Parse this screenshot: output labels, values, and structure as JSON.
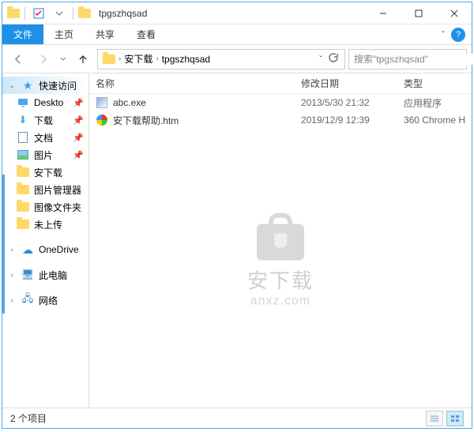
{
  "title": "tpgszhqsad",
  "ribbon": {
    "file": "文件",
    "home": "主页",
    "share": "共享",
    "view": "查看"
  },
  "breadcrumb": {
    "seg1": "安下载",
    "seg2": "tpgszhqsad"
  },
  "search": {
    "placeholder": "搜索\"tpgszhqsad\""
  },
  "sidebar": {
    "quick": "快速访问",
    "items": [
      {
        "label": "Deskto"
      },
      {
        "label": "下载"
      },
      {
        "label": "文档"
      },
      {
        "label": "图片"
      },
      {
        "label": "安下载"
      },
      {
        "label": "图片管理器"
      },
      {
        "label": "图像文件夹"
      },
      {
        "label": "未上传"
      }
    ],
    "onedrive": "OneDrive",
    "thispc": "此电脑",
    "network": "网络"
  },
  "columns": {
    "name": "名称",
    "date": "修改日期",
    "type": "类型"
  },
  "files": [
    {
      "name": "abc.exe",
      "date": "2013/5/30 21:32",
      "type": "应用程序",
      "icon": "exe"
    },
    {
      "name": "安下载帮助.htm",
      "date": "2019/12/9 12:39",
      "type": "360 Chrome H",
      "icon": "htm"
    }
  ],
  "watermark": {
    "cn": "安下载",
    "en": "anxz.com"
  },
  "status": {
    "text": "2 个项目"
  }
}
